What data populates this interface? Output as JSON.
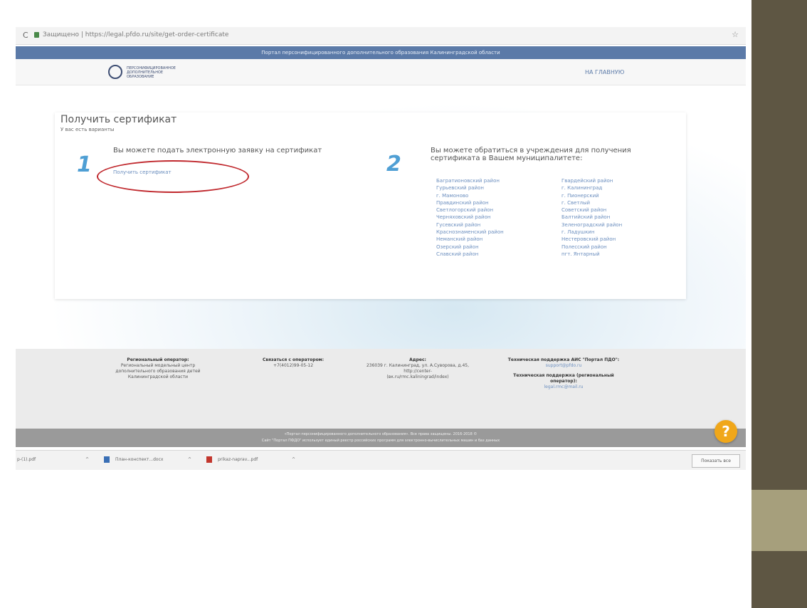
{
  "browser": {
    "url": "Защищено | https://legal.pfdo.ru/site/get-order-certificate",
    "reload_icon": "reload-icon",
    "star_icon": "star-icon"
  },
  "banner": {
    "text": "Портал персонифицированного дополнительного образования Калининградской области"
  },
  "header": {
    "logo_text": "ПЕРСОНИФИЦИРОВАННОЕ ДОПОЛНИТЕЛЬНОЕ ОБРАЗОВАНИЕ",
    "nav_main": "НА ГЛАВНУЮ"
  },
  "card": {
    "title": "Получить сертификат",
    "subtitle": "У вас есть варианты",
    "option1": {
      "number": "1",
      "heading": "Вы можете подать электронную заявку на сертификат",
      "link": "Получить сертификат"
    },
    "option2": {
      "number": "2",
      "heading": "Вы можете обратиться в учреждения для получения сертификата в Вашем муниципалитете:",
      "districts_left": [
        "Багратионовский район",
        "Гурьевский район",
        "г. Мамоново",
        "Правдинский район",
        "Светлогорский район",
        "Черняховский район",
        "Гусевский район",
        "Краснознаменский район",
        "Неманский район",
        "Озерский район",
        "Славский район"
      ],
      "districts_right": [
        "Гвардейский район",
        "г. Калининград",
        "г. Пионерский",
        "г. Светлый",
        "Советский район",
        "Балтийский район",
        "Зеленоградский район",
        "г. Ладушкин",
        "Нестеровский район",
        "Полесский район",
        "пгт. Янтарный"
      ]
    }
  },
  "footer": {
    "col1": {
      "heading": "Региональный оператор:",
      "text": "Региональный модельный центр дополнительного образования детей Калининградской области"
    },
    "col2": {
      "heading": "Связаться с оператором:",
      "phone": "+7(4012)99-05-12"
    },
    "col3": {
      "heading": "Адрес:",
      "text": "236039 г. Калининград, ул. А.Суворова, д.45, http://center-",
      "text2": "(вк.ru/rmc.kaliningrad/index)"
    },
    "col4": {
      "heading": "Техническая поддержка АИС \"Портал ПДО\":",
      "email": "support@pfdo.ru",
      "heading2": "Техническая поддержка (региональный оператор):",
      "email2": "legal.rmc@mail.ru"
    }
  },
  "copyright": {
    "line1": "«Портал персонифицированного дополнительного образования». Все права защищены. 2016-2018 ©",
    "line2": "Сайт \"Портал ПФДО\" использует единый реестр российских программ для электронно-вычислительных машин и баз данных"
  },
  "help_label": "?",
  "downloads": {
    "item0": "р-(1).pdf",
    "item1": "План-конспект...docx",
    "item2": "prikaz-naprav...pdf",
    "show_all": "Показать все"
  }
}
